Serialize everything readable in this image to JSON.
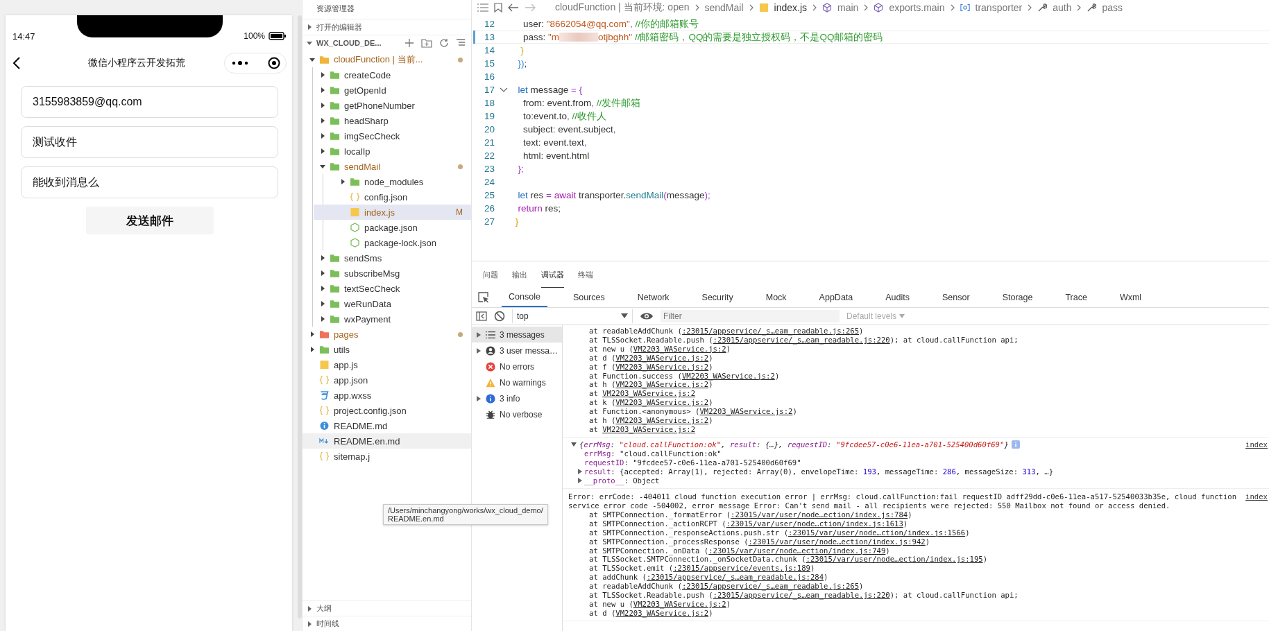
{
  "simulator": {
    "status_bar": {
      "time": "14:47",
      "battery": "100%"
    },
    "nav": {
      "title": "微信小程序云开发拓荒"
    },
    "fields": [
      {
        "value": "3155983859@qq.com"
      },
      {
        "value": "测试收件"
      },
      {
        "value": "能收到消息么"
      }
    ],
    "button": "发送邮件"
  },
  "explorer": {
    "title": "资源管理器",
    "open_editors": {
      "label": "打开的编辑器",
      "expanded": false
    },
    "project": {
      "label": "WX_CLOUD_DE...",
      "expanded": true,
      "tree": [
        {
          "label": "cloudFunction | 当前...",
          "kind": "cloud-folder",
          "expanded": true,
          "modified": true,
          "selected": false,
          "hovered": false,
          "children": [
            {
              "label": "createCode",
              "kind": "folder",
              "expanded": false,
              "modified": false,
              "selected": false,
              "hovered": false
            },
            {
              "label": "getOpenId",
              "kind": "folder",
              "expanded": false,
              "modified": false,
              "selected": false,
              "hovered": false
            },
            {
              "label": "getPhoneNumber",
              "kind": "folder",
              "expanded": false,
              "modified": false,
              "selected": false,
              "hovered": false
            },
            {
              "label": "headSharp",
              "kind": "folder",
              "expanded": false,
              "modified": false,
              "selected": false,
              "hovered": false
            },
            {
              "label": "imgSecCheck",
              "kind": "folder",
              "expanded": false,
              "modified": false,
              "selected": false,
              "hovered": false
            },
            {
              "label": "localIp",
              "kind": "folder",
              "expanded": false,
              "modified": false,
              "selected": false,
              "hovered": false
            },
            {
              "label": "sendMail",
              "kind": "folder",
              "expanded": true,
              "modified": true,
              "selected": false,
              "hovered": false,
              "children": [
                {
                  "label": "node_modules",
                  "kind": "folder",
                  "expanded": false,
                  "modified": false,
                  "selected": false,
                  "hovered": false
                },
                {
                  "label": "config.json",
                  "kind": "json",
                  "modified": false,
                  "selected": false,
                  "hovered": false
                },
                {
                  "label": "index.js",
                  "kind": "js",
                  "modified": true,
                  "badge": "M",
                  "selected": true,
                  "hovered": false
                },
                {
                  "label": "package.json",
                  "kind": "node",
                  "modified": false,
                  "selected": false,
                  "hovered": false
                },
                {
                  "label": "package-lock.json",
                  "kind": "node",
                  "modified": false,
                  "selected": false,
                  "hovered": false
                }
              ]
            },
            {
              "label": "sendSms",
              "kind": "folder",
              "expanded": false,
              "modified": false,
              "selected": false,
              "hovered": false
            },
            {
              "label": "subscribeMsg",
              "kind": "folder",
              "expanded": false,
              "modified": false,
              "selected": false,
              "hovered": false
            },
            {
              "label": "textSecCheck",
              "kind": "folder",
              "expanded": false,
              "modified": false,
              "selected": false,
              "hovered": false
            },
            {
              "label": "weRunData",
              "kind": "folder",
              "expanded": false,
              "modified": false,
              "selected": false,
              "hovered": false
            },
            {
              "label": "wxPayment",
              "kind": "folder",
              "expanded": false,
              "modified": false,
              "selected": false,
              "hovered": false
            }
          ]
        },
        {
          "label": "pages",
          "kind": "pages-folder",
          "expanded": false,
          "modified": true,
          "selected": false,
          "hovered": false
        },
        {
          "label": "utils",
          "kind": "utils-folder",
          "expanded": false,
          "modified": false,
          "selected": false,
          "hovered": false
        },
        {
          "label": "app.js",
          "kind": "js",
          "modified": false,
          "selected": false,
          "hovered": false
        },
        {
          "label": "app.json",
          "kind": "json",
          "modified": false,
          "selected": false,
          "hovered": false
        },
        {
          "label": "app.wxss",
          "kind": "css",
          "modified": false,
          "selected": false,
          "hovered": false
        },
        {
          "label": "project.config.json",
          "kind": "json",
          "modified": false,
          "selected": false,
          "hovered": false
        },
        {
          "label": "README.md",
          "kind": "info",
          "modified": false,
          "selected": false,
          "hovered": false
        },
        {
          "label": "README.en.md",
          "kind": "markdown",
          "modified": false,
          "selected": false,
          "hovered": true
        },
        {
          "label": "sitemap.j",
          "kind": "json",
          "modified": false,
          "selected": false,
          "hovered": false
        }
      ]
    },
    "tooltip": {
      "lines": [
        "/Users/minchangyong/works/wx_cloud_demo/",
        "README.en.md"
      ]
    },
    "bottom_sections": [
      {
        "label": "大纲",
        "expanded": false
      },
      {
        "label": "时间线",
        "expanded": false
      }
    ]
  },
  "editor": {
    "breadcrumb": [
      {
        "label": "cloudFunction | 当前环境: open",
        "kind": "folder"
      },
      {
        "label": "sendMail",
        "kind": "folder"
      },
      {
        "label": "index.js",
        "kind": "js"
      },
      {
        "label": "main",
        "kind": "module"
      },
      {
        "label": "exports.main",
        "kind": "module"
      },
      {
        "label": "transporter",
        "kind": "variable"
      },
      {
        "label": "auth",
        "kind": "wrench"
      },
      {
        "label": "pass",
        "kind": "wrench"
      }
    ],
    "lines": [
      {
        "number": "12",
        "current": false,
        "foldable": false,
        "tokens": [
          {
            "kind": "plain",
            "text": "    user: "
          },
          {
            "kind": "string",
            "text": "\"8662054@qq.com\""
          },
          {
            "kind": "punct",
            "text": ", "
          },
          {
            "kind": "comment",
            "text": "//你的邮箱账号"
          }
        ]
      },
      {
        "number": "13",
        "current": true,
        "foldable": false,
        "tokens": [
          {
            "kind": "plain",
            "text": "    pass: "
          },
          {
            "kind": "string",
            "text": "\"m"
          },
          {
            "kind": "blur"
          },
          {
            "kind": "string",
            "text": "otjbghh\""
          },
          {
            "kind": "comment",
            "text": " //邮箱密码，QQ的需要是独立授权码，不是QQ邮箱的密码"
          }
        ]
      },
      {
        "number": "14",
        "current": false,
        "foldable": false,
        "tokens": [
          {
            "kind": "bracket3",
            "text": "   }"
          }
        ]
      },
      {
        "number": "15",
        "current": false,
        "foldable": false,
        "tokens": [
          {
            "kind": "bracket2",
            "text": "  })"
          },
          {
            "kind": "plain",
            "text": ";"
          }
        ]
      },
      {
        "number": "16",
        "current": false,
        "foldable": false
      },
      {
        "number": "17",
        "current": false,
        "foldable": true,
        "tokens": [
          {
            "kind": "keyword",
            "text": "  let"
          },
          {
            "kind": "plain",
            "text": " message "
          },
          {
            "kind": "punct",
            "text": "= {"
          }
        ]
      },
      {
        "number": "18",
        "current": false,
        "foldable": false,
        "tokens": [
          {
            "kind": "plain",
            "text": "    from: event.from"
          },
          {
            "kind": "punct",
            "text": ", "
          },
          {
            "kind": "comment",
            "text": "//发件邮箱"
          }
        ]
      },
      {
        "number": "19",
        "current": false,
        "foldable": false,
        "tokens": [
          {
            "kind": "plain",
            "text": "    to:event.to"
          },
          {
            "kind": "punct",
            "text": ", "
          },
          {
            "kind": "comment",
            "text": "//收件人"
          }
        ]
      },
      {
        "number": "20",
        "current": false,
        "foldable": false,
        "tokens": [
          {
            "kind": "plain",
            "text": "    subject: event.subject"
          },
          {
            "kind": "punct",
            "text": ","
          }
        ]
      },
      {
        "number": "21",
        "current": false,
        "foldable": false,
        "tokens": [
          {
            "kind": "plain",
            "text": "    text: event.text"
          },
          {
            "kind": "punct",
            "text": ","
          }
        ]
      },
      {
        "number": "22",
        "current": false,
        "foldable": false,
        "tokens": [
          {
            "kind": "plain",
            "text": "    html: event.html"
          }
        ]
      },
      {
        "number": "23",
        "current": false,
        "foldable": false,
        "tokens": [
          {
            "kind": "punct",
            "text": "  };"
          }
        ]
      },
      {
        "number": "24",
        "current": false,
        "foldable": false
      },
      {
        "number": "25",
        "current": false,
        "foldable": false,
        "tokens": [
          {
            "kind": "keyword",
            "text": "  let"
          },
          {
            "kind": "plain",
            "text": " res "
          },
          {
            "kind": "punct",
            "text": "= "
          },
          {
            "kind": "control",
            "text": "await"
          },
          {
            "kind": "plain",
            "text": " transporter."
          },
          {
            "kind": "func",
            "text": "sendMail"
          },
          {
            "kind": "punct",
            "text": "("
          },
          {
            "kind": "plain",
            "text": "message"
          },
          {
            "kind": "punct",
            "text": ");"
          }
        ]
      },
      {
        "number": "26",
        "current": false,
        "foldable": false,
        "tokens": [
          {
            "kind": "control",
            "text": "  return"
          },
          {
            "kind": "plain",
            "text": " res;"
          }
        ]
      },
      {
        "number": "27",
        "current": false,
        "foldable": false,
        "tokens": [
          {
            "kind": "bracket3",
            "text": " }"
          }
        ]
      }
    ]
  },
  "console": {
    "panel_tabs": [
      {
        "label": "问题",
        "selected": false
      },
      {
        "label": "输出",
        "selected": false
      },
      {
        "label": "调试器",
        "selected": true
      },
      {
        "label": "终端",
        "selected": false
      }
    ],
    "devtools_tabs": [
      {
        "label": "Console",
        "selected": true
      },
      {
        "label": "Sources",
        "selected": false
      },
      {
        "label": "Network",
        "selected": false
      },
      {
        "label": "Security",
        "selected": false
      },
      {
        "label": "Mock",
        "selected": false
      },
      {
        "label": "AppData",
        "selected": false
      },
      {
        "label": "Audits",
        "selected": false
      },
      {
        "label": "Sensor",
        "selected": false
      },
      {
        "label": "Storage",
        "selected": false
      },
      {
        "label": "Trace",
        "selected": false
      },
      {
        "label": "Wxml",
        "selected": false
      }
    ],
    "toolbar": {
      "context": "top",
      "filter_placeholder": "Filter",
      "levels": "Default levels"
    },
    "sidebar": [
      {
        "label": "3 messages",
        "kind": "list",
        "expandable": true,
        "selected": true
      },
      {
        "label": "3 user messa…",
        "kind": "user",
        "expandable": true,
        "selected": false
      },
      {
        "label": "No errors",
        "kind": "error",
        "expandable": false,
        "selected": false
      },
      {
        "label": "No warnings",
        "kind": "warning",
        "expandable": false,
        "selected": false
      },
      {
        "label": "3 info",
        "kind": "info",
        "expandable": true,
        "selected": false
      },
      {
        "label": "No verbose",
        "kind": "verbose",
        "expandable": false,
        "selected": false
      }
    ],
    "logs": [
      {
        "kind": "stack",
        "lines": [
          {
            "pre": "at readableAddChunk (",
            "link": ":23015/appservice/_s…eam_readable.js:265",
            "post": ")"
          },
          {
            "pre": "at TLSSocket.Readable.push (",
            "link": ":23015/appservice/_s…eam_readable.js:220",
            "post": "); at cloud.callFunction api;"
          },
          {
            "pre": "at new u (",
            "link": "VM2203_WAService.js:2",
            "post": ")"
          },
          {
            "pre": "at d (",
            "link": "VM2203_WAService.js:2",
            "post": ")"
          },
          {
            "pre": "at f (",
            "link": "VM2203_WAService.js:2",
            "post": ")"
          },
          {
            "pre": "at Function.success (",
            "link": "VM2203_WAService.js:2",
            "post": ")"
          },
          {
            "pre": "at h (",
            "link": "VM2203_WAService.js:2",
            "post": ")"
          },
          {
            "pre": "at ",
            "link": "VM2203_WAService.js:2"
          },
          {
            "pre": "at k (",
            "link": "VM2203_WAService.js:2",
            "post": ")"
          },
          {
            "pre": "at Function.<anonymous> (",
            "link": "VM2203_WAService.js:2",
            "post": ")"
          },
          {
            "pre": "at h (",
            "link": "VM2203_WAService.js:2",
            "post": ")"
          },
          {
            "pre": "at ",
            "link": "VM2203_WAService.js:2"
          }
        ]
      },
      {
        "kind": "object",
        "expanded": true,
        "source": "index",
        "summary": [
          {
            "kind": "punct",
            "text": "{"
          },
          {
            "kind": "key",
            "text": "errMsg"
          },
          {
            "kind": "punct",
            "text": ": "
          },
          {
            "kind": "string",
            "text": "\"cloud.callFunction:ok\""
          },
          {
            "kind": "punct",
            "text": ", "
          },
          {
            "kind": "key",
            "text": "result"
          },
          {
            "kind": "punct",
            "text": ": {…}, "
          },
          {
            "kind": "key",
            "text": "requestID"
          },
          {
            "kind": "punct",
            "text": ": "
          },
          {
            "kind": "string",
            "text": "\"9fcdee57-c0e6-11ea-a701-525400d60f69\""
          },
          {
            "kind": "punct",
            "text": "}"
          }
        ],
        "properties": [
          {
            "expandable": false,
            "tokens": [
              {
                "kind": "key",
                "text": "errMsg"
              },
              {
                "kind": "punct",
                "text": ": "
              },
              {
                "kind": "value",
                "text": "\"cloud.callFunction:ok\""
              }
            ]
          },
          {
            "expandable": false,
            "tokens": [
              {
                "kind": "key",
                "text": "requestID"
              },
              {
                "kind": "punct",
                "text": ": "
              },
              {
                "kind": "value",
                "text": "\"9fcdee57-c0e6-11ea-a701-525400d60f69\""
              }
            ]
          },
          {
            "expandable": true,
            "tokens": [
              {
                "kind": "key",
                "text": "result"
              },
              {
                "kind": "punct",
                "text": ": {accepted: Array(1), rejected: Array(0), envelopeTime: "
              },
              {
                "kind": "number",
                "text": "193"
              },
              {
                "kind": "punct",
                "text": ", messageTime: "
              },
              {
                "kind": "number",
                "text": "286"
              },
              {
                "kind": "punct",
                "text": ", messageSize: "
              },
              {
                "kind": "number",
                "text": "313"
              },
              {
                "kind": "punct",
                "text": ", …}"
              }
            ]
          },
          {
            "expandable": true,
            "tokens": [
              {
                "kind": "key",
                "text": "__proto__"
              },
              {
                "kind": "punct",
                "text": ": Object"
              }
            ]
          }
        ]
      },
      {
        "kind": "error",
        "source": "index",
        "message": "Error: errCode: -404011 cloud function execution error | errMsg: cloud.callFunction:fail requestID adff29dd-c0e6-11ea-a517-52540033b35e, cloud function service error code -504002, error message Error: Can't send mail - all recipients were rejected: 550 Mailbox not found or access denied.",
        "lines": [
          {
            "pre": "at SMTPConnection._formatError (",
            "link": ":23015/var/user/node…ection/index.js:784",
            "post": ")"
          },
          {
            "pre": "at SMTPConnection._actionRCPT (",
            "link": ":23015/var/user/node…ction/index.js:1613",
            "post": ")"
          },
          {
            "pre": "at SMTPConnection._responseActions.push.str (",
            "link": ":23015/var/user/node…ction/index.js:1566",
            "post": ")"
          },
          {
            "pre": "at SMTPConnection._processResponse (",
            "link": ":23015/var/user/node…ection/index.js:942",
            "post": ")"
          },
          {
            "pre": "at SMTPConnection._onData (",
            "link": ":23015/var/user/node…ection/index.js:749",
            "post": ")"
          },
          {
            "pre": "at TLSSocket.SMTPConnection._onSocketData.chunk (",
            "link": ":23015/var/user/node…ection/index.js:195",
            "post": ")"
          },
          {
            "pre": "at TLSSocket.emit (",
            "link": ":23015/appservice/events.js:189",
            "post": ")"
          },
          {
            "pre": "at addChunk (",
            "link": ":23015/appservice/_s…eam_readable.js:284",
            "post": ")"
          },
          {
            "pre": "at readableAddChunk (",
            "link": ":23015/appservice/_s…eam_readable.js:265",
            "post": ")"
          },
          {
            "pre": "at TLSSocket.Readable.push (",
            "link": ":23015/appservice/_s…eam_readable.js:220",
            "post": "); at cloud.callFunction api;"
          },
          {
            "pre": "at new u (",
            "link": "VM2203_WAService.js:2",
            "post": ")"
          },
          {
            "pre": "at d (",
            "link": "VM2203_WAService.js:2",
            "post": ")"
          }
        ]
      }
    ]
  }
}
